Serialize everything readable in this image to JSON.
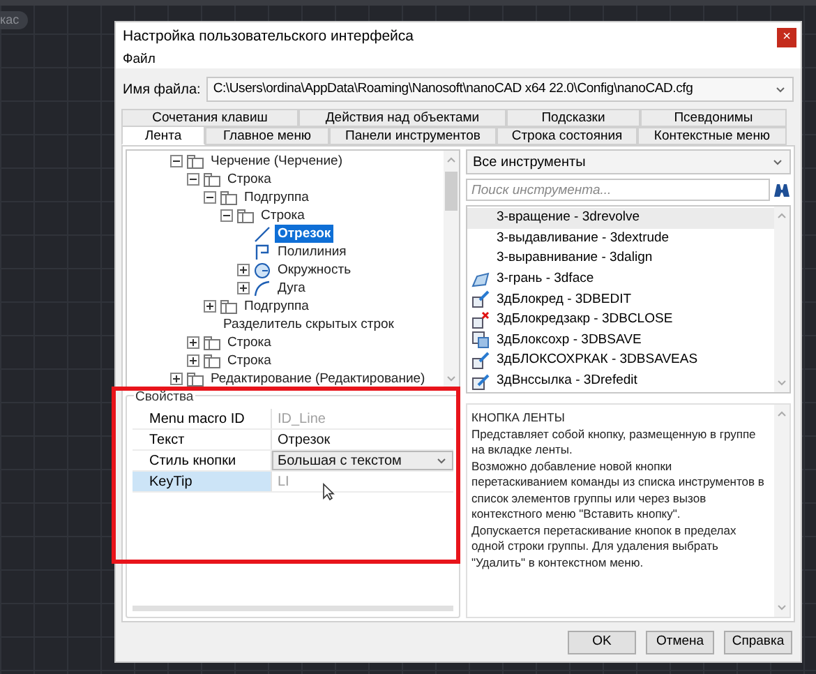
{
  "background": {
    "chip": "кас"
  },
  "window": {
    "title": "Настройка пользовательского интерфейса",
    "close": "×"
  },
  "menu": [
    "Файл"
  ],
  "file": {
    "label": "Имя файла:",
    "value": "C:\\Users\\ordina\\AppData\\Roaming\\Nanosoft\\nanoCAD x64 22.0\\Config\\nanoCAD.cfg"
  },
  "tabs": [
    [
      {
        "label": "Сочетания клавиш",
        "selected": false
      },
      {
        "label": "Действия над объектами",
        "selected": false
      },
      {
        "label": "Подсказки",
        "selected": false
      },
      {
        "label": "Псевдонимы",
        "selected": false
      }
    ],
    [
      {
        "label": "Лента",
        "selected": true
      },
      {
        "label": "Главное меню",
        "selected": false
      },
      {
        "label": "Панели инструментов",
        "selected": false
      },
      {
        "label": "Строка состояния",
        "selected": false
      },
      {
        "label": "Контекстные меню",
        "selected": false
      }
    ]
  ],
  "tree": [
    {
      "label": "Черчение (Черчение)",
      "kind": "group",
      "expanded": true,
      "selected": false,
      "children": [
        {
          "label": "Строка",
          "kind": "group",
          "expanded": true,
          "selected": false,
          "children": [
            {
              "label": "Подгруппа",
              "kind": "group",
              "expanded": true,
              "selected": false,
              "children": [
                {
                  "label": "Строка",
                  "kind": "group",
                  "expanded": true,
                  "selected": false,
                  "children": [
                    {
                      "label": "Отрезок",
                      "kind": "line",
                      "selected": true
                    },
                    {
                      "label": "Полилиния",
                      "kind": "polyline",
                      "selected": false
                    },
                    {
                      "label": "Окружность",
                      "kind": "circle",
                      "expanded": false,
                      "selected": false
                    },
                    {
                      "label": "Дуга",
                      "kind": "arc",
                      "expanded": false,
                      "selected": false
                    }
                  ]
                }
              ]
            },
            {
              "label": "Подгруппа",
              "kind": "group",
              "expanded": false,
              "selected": false
            },
            {
              "label": "Разделитель скрытых строк",
              "kind": "separator",
              "selected": false
            }
          ]
        },
        {
          "label": "Строка",
          "kind": "group",
          "expanded": false,
          "selected": false
        },
        {
          "label": "Строка",
          "kind": "group",
          "expanded": false,
          "selected": false
        }
      ]
    },
    {
      "label": "Редактирование (Редактирование)",
      "kind": "group",
      "expanded": false,
      "selected": false
    }
  ],
  "properties": {
    "title": "Свойства",
    "rows": [
      {
        "name": "Menu macro ID",
        "value": "ID_Line",
        "kind": "text",
        "readonly": true,
        "selected": false
      },
      {
        "name": "Текст",
        "value": "Отрезок",
        "kind": "text",
        "readonly": false,
        "selected": false
      },
      {
        "name": "Стиль кнопки",
        "value": "Большая с текстом",
        "kind": "dropdown",
        "readonly": false,
        "selected": false
      },
      {
        "name": "KeyTip",
        "value": "LI",
        "kind": "text",
        "readonly": true,
        "selected": true
      }
    ]
  },
  "tools": {
    "filter": "Все инструменты",
    "search": {
      "placeholder": "Поиск инструмента..."
    },
    "items": [
      {
        "label": "3-вращение - 3drevolve",
        "kind": "none",
        "selected": true
      },
      {
        "label": "3-выдавливание - 3dextrude",
        "kind": "none",
        "selected": false
      },
      {
        "label": "3-выравнивание - 3dalign",
        "kind": "none",
        "selected": false
      },
      {
        "label": "3-грань - 3dface",
        "kind": "face",
        "selected": false
      },
      {
        "label": "3дБлокред - 3DBEDIT",
        "kind": "block-edit",
        "selected": false
      },
      {
        "label": "3дБлокредзакр - 3DBCLOSE",
        "kind": "block-close",
        "selected": false
      },
      {
        "label": "3дБлоксохр - 3DBSAVE",
        "kind": "block-save",
        "selected": false
      },
      {
        "label": "3дБЛОКСОХРКАК - 3DBSAVEAS",
        "kind": "block-edit",
        "selected": false
      },
      {
        "label": "3дВнссылка - 3Drefedit",
        "kind": "refedit",
        "selected": false
      }
    ]
  },
  "description": {
    "title": "КНОПКА ЛЕНТЫ",
    "paragraphs": [
      "Представляет собой кнопку, размещенную в группе на вкладке ленты.",
      "Возможно добавление новой кнопки перетаскиванием команды из списка инструментов в список элементов группы или через вызов контекстного меню \"Вставить кнопку\".",
      "Допускается перетаскивание кнопок в пределах одной строки группы. Для удаления выбрать \"Удалить\" в контекстном меню."
    ]
  },
  "buttons": [
    "OK",
    "Отмена",
    "Справка"
  ]
}
